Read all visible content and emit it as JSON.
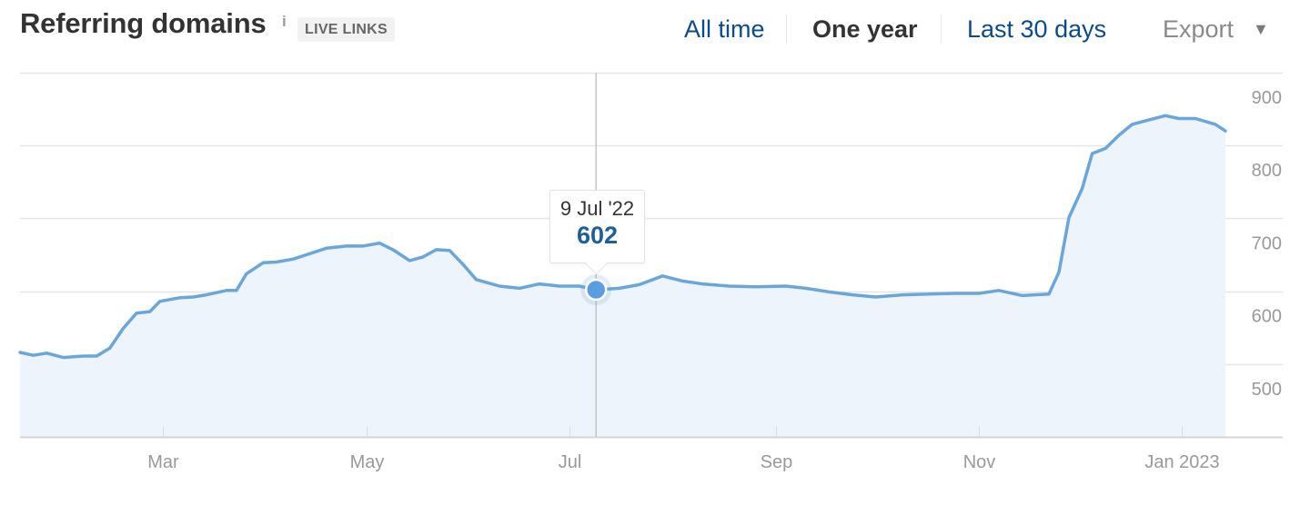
{
  "header": {
    "title": "Referring domains",
    "info_icon": "i",
    "badge": "LIVE LINKS",
    "ranges": [
      {
        "label": "All time",
        "state": "link"
      },
      {
        "label": "One year",
        "state": "active"
      },
      {
        "label": "Last 30 days",
        "state": "link"
      }
    ],
    "export_label": "Export",
    "export_caret": "▼"
  },
  "colors": {
    "line": "#6aa6d8",
    "area": "#eef4fb",
    "grid": "#e6e6e6",
    "axis_text": "#999999",
    "marker": "#5b9ee0",
    "tooltip_value": "#1f5f99",
    "link": "#0b4a8b"
  },
  "tooltip": {
    "date": "9 Jul '22",
    "value": "602"
  },
  "chart_data": {
    "type": "area",
    "title": "Referring domains",
    "xlabel": "",
    "ylabel": "",
    "x_range": [
      "2022-01-17",
      "2023-01-14"
    ],
    "ylim": [
      400,
      900
    ],
    "y_ticks": [
      500,
      600,
      700,
      800,
      900
    ],
    "y_tick_labels": [
      "500",
      "600",
      "700",
      "800",
      "900"
    ],
    "x_ticks": [
      {
        "date": "2022-03-01",
        "label": "Mar"
      },
      {
        "date": "2022-05-01",
        "label": "May"
      },
      {
        "date": "2022-07-01",
        "label": "Jul"
      },
      {
        "date": "2022-09-01",
        "label": "Sep"
      },
      {
        "date": "2022-11-01",
        "label": "Nov"
      },
      {
        "date": "2023-01-01",
        "label": "Jan 2023"
      }
    ],
    "grid": true,
    "legend": "none",
    "highlight": {
      "date": "2022-07-09",
      "value": 602
    },
    "series": [
      {
        "name": "Referring domains",
        "points": [
          [
            "2022-01-17",
            516
          ],
          [
            "2022-01-21",
            512
          ],
          [
            "2022-01-25",
            515
          ],
          [
            "2022-01-30",
            509
          ],
          [
            "2022-02-05",
            511
          ],
          [
            "2022-02-09",
            511
          ],
          [
            "2022-02-13",
            522
          ],
          [
            "2022-02-17",
            549
          ],
          [
            "2022-02-21",
            570
          ],
          [
            "2022-02-25",
            572
          ],
          [
            "2022-02-28",
            586
          ],
          [
            "2022-03-06",
            591
          ],
          [
            "2022-03-10",
            592
          ],
          [
            "2022-03-14",
            595
          ],
          [
            "2022-03-20",
            601
          ],
          [
            "2022-03-23",
            601
          ],
          [
            "2022-03-26",
            624
          ],
          [
            "2022-03-31",
            639
          ],
          [
            "2022-04-04",
            640
          ],
          [
            "2022-04-09",
            644
          ],
          [
            "2022-04-13",
            650
          ],
          [
            "2022-04-19",
            659
          ],
          [
            "2022-04-25",
            662
          ],
          [
            "2022-04-30",
            662
          ],
          [
            "2022-05-05",
            666
          ],
          [
            "2022-05-09",
            657
          ],
          [
            "2022-05-14",
            642
          ],
          [
            "2022-05-18",
            647
          ],
          [
            "2022-05-22",
            657
          ],
          [
            "2022-05-26",
            656
          ],
          [
            "2022-05-30",
            637
          ],
          [
            "2022-06-03",
            616
          ],
          [
            "2022-06-10",
            607
          ],
          [
            "2022-06-16",
            604
          ],
          [
            "2022-06-22",
            610
          ],
          [
            "2022-06-28",
            607
          ],
          [
            "2022-07-04",
            607
          ],
          [
            "2022-07-09",
            602
          ],
          [
            "2022-07-16",
            604
          ],
          [
            "2022-07-22",
            609
          ],
          [
            "2022-07-29",
            621
          ],
          [
            "2022-08-04",
            614
          ],
          [
            "2022-08-10",
            610
          ],
          [
            "2022-08-18",
            607
          ],
          [
            "2022-08-26",
            606
          ],
          [
            "2022-09-04",
            607
          ],
          [
            "2022-09-10",
            604
          ],
          [
            "2022-09-17",
            599
          ],
          [
            "2022-09-24",
            595
          ],
          [
            "2022-10-01",
            592
          ],
          [
            "2022-10-09",
            595
          ],
          [
            "2022-10-17",
            596
          ],
          [
            "2022-10-25",
            597
          ],
          [
            "2022-11-01",
            597
          ],
          [
            "2022-11-07",
            601
          ],
          [
            "2022-11-14",
            594
          ],
          [
            "2022-11-22",
            596
          ],
          [
            "2022-11-25",
            626
          ],
          [
            "2022-11-28",
            701
          ],
          [
            "2022-12-02",
            741
          ],
          [
            "2022-12-05",
            789
          ],
          [
            "2022-12-09",
            796
          ],
          [
            "2022-12-13",
            814
          ],
          [
            "2022-12-17",
            829
          ],
          [
            "2022-12-22",
            835
          ],
          [
            "2022-12-27",
            841
          ],
          [
            "2022-12-31",
            837
          ],
          [
            "2023-01-05",
            837
          ],
          [
            "2023-01-11",
            829
          ],
          [
            "2023-01-14",
            820
          ]
        ]
      }
    ]
  }
}
